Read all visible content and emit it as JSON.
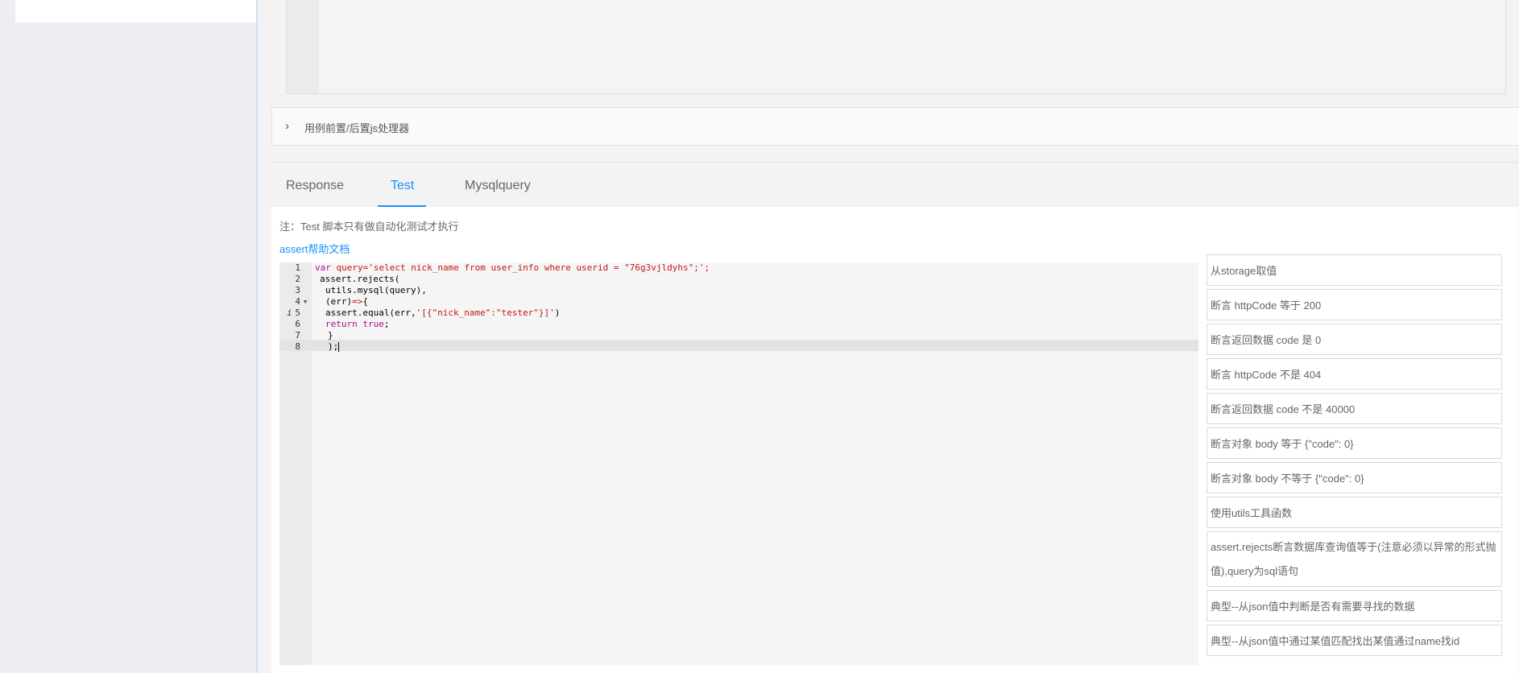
{
  "collapse": {
    "label": "用例前置/后置js处理器"
  },
  "tabs": [
    {
      "label": "Response",
      "active": false
    },
    {
      "label": "Test",
      "active": true
    },
    {
      "label": "Mysqlquery",
      "active": false
    }
  ],
  "test_panel": {
    "note": "注：Test 脚本只有做自动化测试才执行",
    "doc_link": "assert帮助文档"
  },
  "code": {
    "line_numbers": [
      "1",
      "2",
      "3",
      "4",
      "5",
      "6",
      "7",
      "8"
    ],
    "fold_icon": "triangle-down",
    "info_icon": "i",
    "line1": {
      "kw": "var",
      "plain": " query=",
      "str": "'select nick_name from user_info where userid = \"76g3vjldyhs\";'",
      "tail": ";"
    },
    "line2": "assert.rejects(",
    "line3": "utils.mysql(query),",
    "line4": {
      "plain": "(err)",
      "op": "=>",
      "tail": "{"
    },
    "line5": {
      "plain": "assert.equal(err,",
      "str": "'[{\"nick_name\":\"tester\"}]'",
      "tail": ")"
    },
    "line6": {
      "kw": "return",
      "space": " ",
      "kw2": "true",
      "tail": ";"
    },
    "line7": "}",
    "line8": ");"
  },
  "snippets": [
    "从storage取值",
    "断言 httpCode 等于 200",
    "断言返回数据 code 是 0",
    "断言 httpCode 不是 404",
    "断言返回数据 code 不是 40000",
    "断言对象 body 等于 {\"code\": 0}",
    "断言对象 body 不等于 {\"code\": 0}",
    "使用utils工具函数",
    "assert.rejects断言数据库查询值等于(注意必须以异常的形式抛值),query为sql语句",
    "典型--从json值中判断是否有需要寻找的数据",
    "典型--从json值中通过某值匹配找出某值通过name找id"
  ],
  "colors": {
    "accent": "#1890ff",
    "keyword": "#aa0d91",
    "string": "#c41a16"
  }
}
